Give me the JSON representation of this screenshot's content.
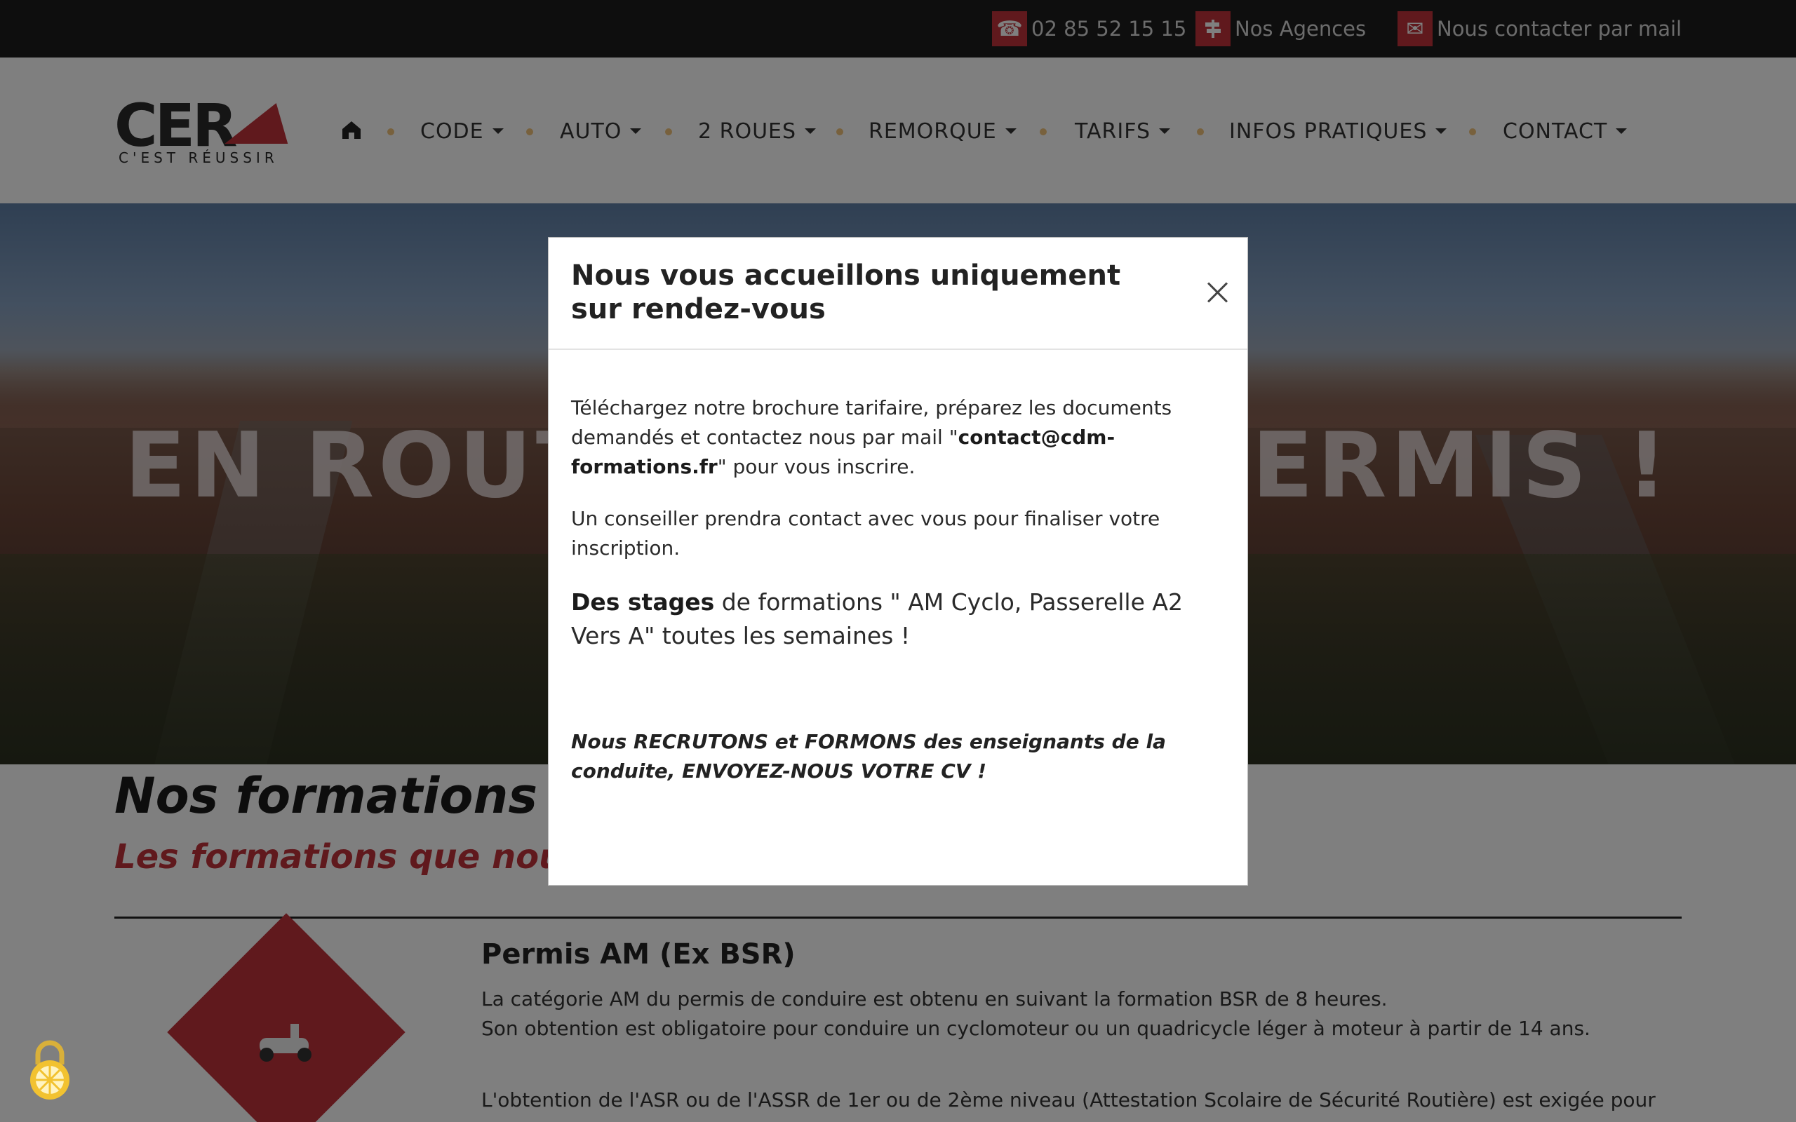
{
  "topbar": {
    "phone": "02 85 52 15 15",
    "agencies": "Nos Agences",
    "mail": "Nous contacter par mail"
  },
  "logo": {
    "word": "CER",
    "tagline": "C'EST RÉUSSIR"
  },
  "nav": {
    "items": [
      {
        "label": "CODE"
      },
      {
        "label": "AUTO"
      },
      {
        "label": "2 ROUES"
      },
      {
        "label": "REMORQUE"
      },
      {
        "label": "TARIFS"
      },
      {
        "label": "INFOS PRATIQUES"
      },
      {
        "label": "CONTACT"
      }
    ]
  },
  "hero": {
    "title": "EN ROUTE VERS LE PERMIS !"
  },
  "section": {
    "title": "Nos formations",
    "subtitle": "Les formations que nous proposons",
    "item_title": "Permis AM (Ex BSR)",
    "item_p1": "La catégorie AM du permis de conduire est obtenu en suivant la formation BSR de 8 heures.",
    "item_p2": "Son obtention est obligatoire pour conduire un cyclomoteur ou un quadricycle léger à moteur à partir de 14 ans.",
    "item_p3": "L'obtention de l'ASR ou de l'ASSR de 1er ou de 2ème niveau (Attestation Scolaire de Sécurité Routière) est exigée pour"
  },
  "modal": {
    "title": "Nous vous accueillons uniquement sur rendez-vous",
    "p1_pre": "Téléchargez notre brochure tarifaire, préparez les documents demandés et contactez nous par mail  \"",
    "p1_email": "contact@cdm-formations.fr",
    "p1_post": "\" pour vous inscrire.",
    "p2": "Un conseiller prendra contact avec vous pour finaliser votre inscription.",
    "p3_bold": "Des stages",
    "p3_rest": " de formations \" AM Cyclo, Passerelle A2 Vers A\"   toutes les semaines !",
    "p4": "Nous RECRUTONS et FORMONS des enseignants de la conduite, ENVOYEZ-NOUS VOTRE CV !"
  },
  "colors": {
    "accent": "#c0323a",
    "topbar": "#1c1c1c",
    "nav_dot": "#f0c27a"
  }
}
